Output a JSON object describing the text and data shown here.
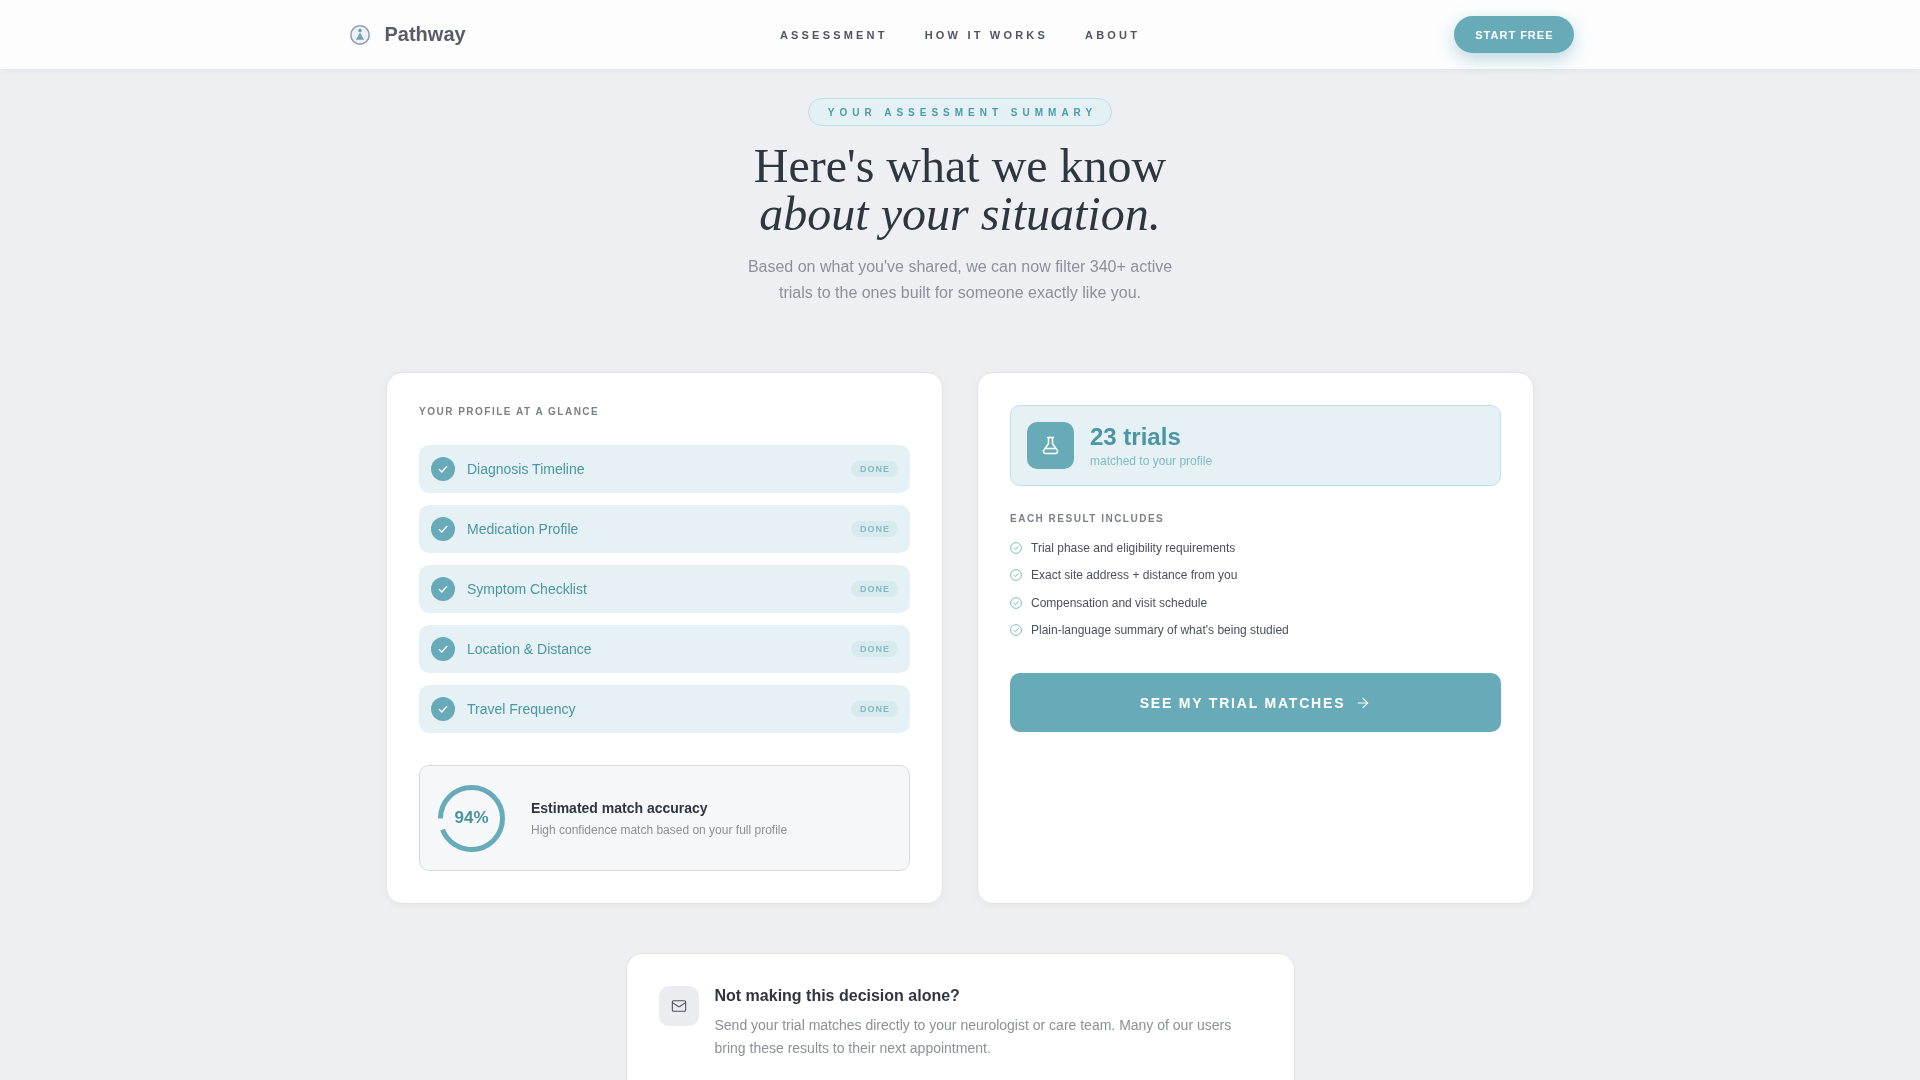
{
  "header": {
    "brand": "Pathway",
    "nav": [
      "ASSESSMENT",
      "HOW IT WORKS",
      "ABOUT"
    ],
    "cta": "START FREE"
  },
  "hero": {
    "badge": "YOUR ASSESSMENT SUMMARY",
    "title": "Here's what we know *about your situation.*",
    "subtitle": "Based on what you've shared, we can now filter 340+ active trials to the ones built for someone exactly like you."
  },
  "profile": {
    "heading": "YOUR PROFILE AT A GLANCE",
    "items": [
      {
        "label": "Diagnosis Timeline",
        "status": "DONE",
        "checked": true
      },
      {
        "label": "Medication Profile",
        "status": "DONE",
        "checked": true
      },
      {
        "label": "Symptom Checklist",
        "status": "DONE",
        "checked": true
      },
      {
        "label": "Location & Distance",
        "status": "DONE",
        "checked": true
      },
      {
        "label": "Travel Frequency",
        "status": "DONE",
        "checked": true
      }
    ],
    "accuracy": {
      "value": "94%",
      "level": 0.94,
      "title": "Estimated match accuracy",
      "description": "High confidence match based on your full profile"
    }
  },
  "results": {
    "count": "23 trials",
    "caption": "matched to your profile",
    "heading": "EACH RESULT INCLUDES",
    "items": [
      "Trial phase and eligibility requirements",
      "Exact site address + distance from you",
      "Compensation and visit schedule",
      "Plain-language summary of what's being studied"
    ],
    "button": "SEE MY TRIAL MATCHES"
  },
  "share": {
    "title": "Not making this decision alone?",
    "body": "Send your trial matches directly to your neurologist or care team. Many of our users bring these results to their next appointment."
  }
}
